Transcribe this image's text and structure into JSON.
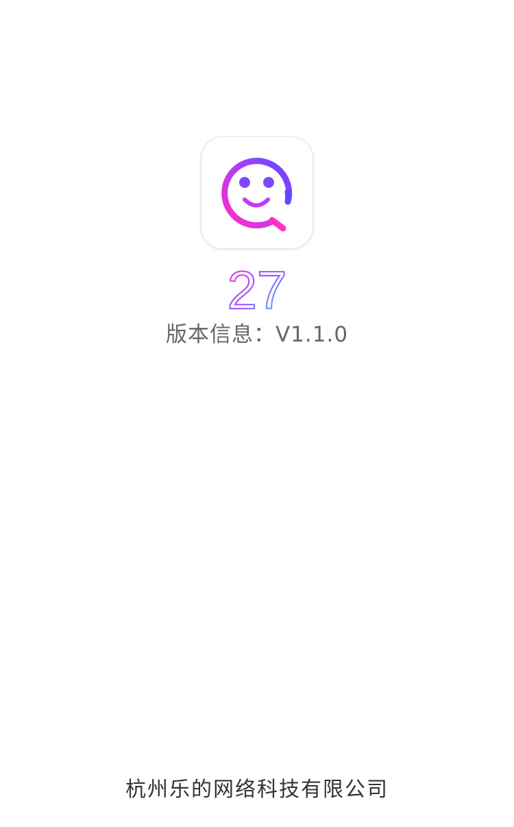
{
  "app": {
    "icon": "smiley-search-logo-icon",
    "name": "27",
    "version_text": "版本信息：V1.1.0",
    "company": "杭州乐的网络科技有限公司"
  },
  "colors": {
    "background": "#ffffff",
    "logo_gradient_start": "#6b4bff",
    "logo_gradient_end": "#ff2fc8",
    "name_gradient": [
      "#ff3ad0",
      "#9b5cff",
      "#3ad8ff"
    ],
    "version_text": "#666666",
    "company_text": "#333333"
  }
}
